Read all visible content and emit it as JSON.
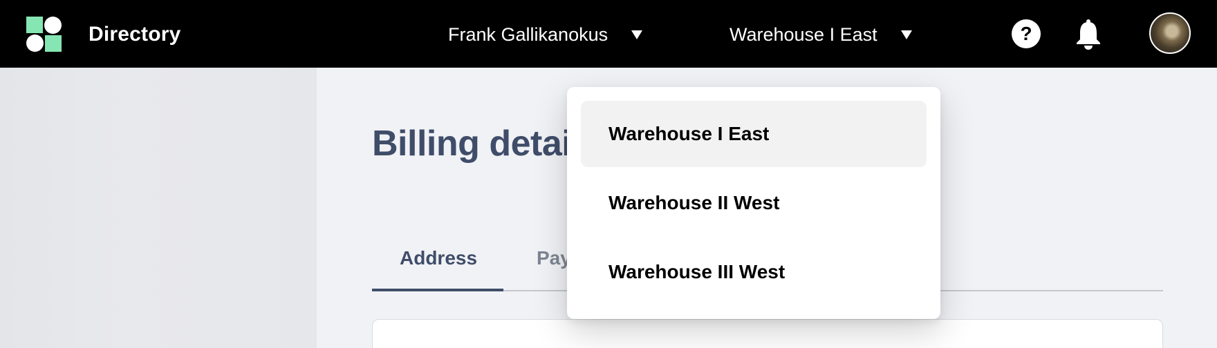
{
  "app": {
    "title": "Directory"
  },
  "header": {
    "user_selector": {
      "label": "Frank Gallikanokus"
    },
    "warehouse_selector": {
      "label": "Warehouse I East"
    }
  },
  "icons": {
    "help": "?"
  },
  "main": {
    "title": "Billing details",
    "tabs": [
      {
        "label": "Address",
        "active": true
      },
      {
        "label": "Pay",
        "active": false
      }
    ]
  },
  "warehouse_menu": {
    "items": [
      {
        "label": "Warehouse I East",
        "selected": true
      },
      {
        "label": "Warehouse II West",
        "selected": false
      },
      {
        "label": "Warehouse III West",
        "selected": false
      }
    ]
  },
  "colors": {
    "topbar": "#000000",
    "brand_green": "#86e6b3",
    "heading": "#3f4d69"
  }
}
